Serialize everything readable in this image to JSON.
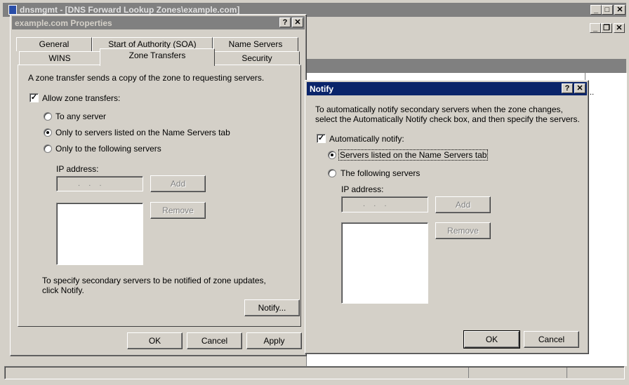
{
  "background_window": {
    "title": "dnsmgmt - [DNS          Forward Lookup Zones\\example.com]",
    "ellipsis": "..."
  },
  "properties": {
    "title": "example.com Properties",
    "help_caption": "?",
    "close_caption": "✕",
    "tabs_row1": [
      "General",
      "Start of Authority (SOA)",
      "Name Servers"
    ],
    "tabs_row2": [
      "WINS",
      "Zone Transfers",
      "Security"
    ],
    "intro": "A zone transfer sends a copy of the zone to requesting servers.",
    "allow_label": "Allow zone transfers:",
    "allow_checked": true,
    "radio_any": "To any server",
    "radio_ns": "Only to servers listed on the Name Servers tab",
    "radio_following": "Only to the following servers",
    "selected_radio": "ns",
    "ip_label": "IP address:",
    "ip_placeholder": ".    .    .",
    "add_label": "Add",
    "remove_label": "Remove",
    "notify_text": "To specify secondary servers to be notified of zone updates, click Notify.",
    "notify_button": "Notify...",
    "ok": "OK",
    "cancel": "Cancel",
    "apply": "Apply"
  },
  "notify": {
    "title": "Notify",
    "help_caption": "?",
    "close_caption": "✕",
    "intro": "To automatically notify secondary servers when the zone changes, select the Automatically Notify check box, and then specify the servers.",
    "auto_label": "Automatically notify:",
    "auto_checked": true,
    "radio_ns": "Servers listed on the Name Servers tab",
    "radio_following": "The following servers",
    "selected_radio": "ns",
    "ip_label": "IP address:",
    "ip_placeholder": ".    .    .",
    "add_label": "Add",
    "remove_label": "Remove",
    "ok": "OK",
    "cancel": "Cancel"
  }
}
